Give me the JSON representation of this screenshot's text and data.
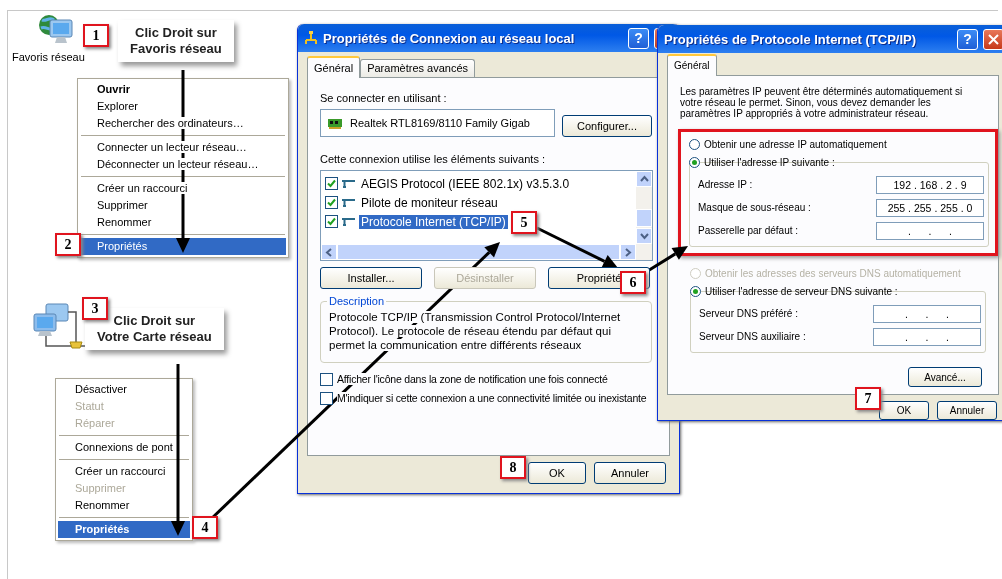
{
  "desktop_icons": [
    {
      "label": "Favoris réseau"
    }
  ],
  "callouts": [
    {
      "lines": [
        "Clic Droit sur",
        "Favoris réseau"
      ]
    },
    {
      "lines": [
        "Clic Droit sur",
        "Votre Carte réseau"
      ]
    }
  ],
  "menus": [
    {
      "items": [
        {
          "kind": "item",
          "label": "Ouvrir",
          "default": true,
          "disabled": false,
          "selected": false
        },
        {
          "kind": "item",
          "label": "Explorer",
          "default": false,
          "disabled": false,
          "selected": false
        },
        {
          "kind": "item",
          "label": "Rechercher des ordinateurs…",
          "default": false,
          "disabled": false,
          "selected": false
        },
        {
          "kind": "separator"
        },
        {
          "kind": "item",
          "label": "Connecter un lecteur réseau…",
          "default": false,
          "disabled": false,
          "selected": false
        },
        {
          "kind": "item",
          "label": "Déconnecter un lecteur réseau…",
          "default": false,
          "disabled": false,
          "selected": false
        },
        {
          "kind": "separator"
        },
        {
          "kind": "item",
          "label": "Créer un raccourci",
          "default": false,
          "disabled": false,
          "selected": false
        },
        {
          "kind": "item",
          "label": "Supprimer",
          "default": false,
          "disabled": false,
          "selected": false
        },
        {
          "kind": "item",
          "label": "Renommer",
          "default": false,
          "disabled": false,
          "selected": false
        },
        {
          "kind": "separator"
        },
        {
          "kind": "item",
          "label": "Propriétés",
          "default": false,
          "disabled": false,
          "selected": true
        }
      ]
    },
    {
      "items": [
        {
          "kind": "item",
          "label": "Désactiver",
          "default": false,
          "disabled": false,
          "selected": false
        },
        {
          "kind": "item",
          "label": "Statut",
          "default": false,
          "disabled": true,
          "selected": false
        },
        {
          "kind": "item",
          "label": "Réparer",
          "default": false,
          "disabled": true,
          "selected": false
        },
        {
          "kind": "separator"
        },
        {
          "kind": "item",
          "label": "Connexions de pont",
          "default": false,
          "disabled": false,
          "selected": false
        },
        {
          "kind": "separator"
        },
        {
          "kind": "item",
          "label": "Créer un raccourci",
          "default": false,
          "disabled": false,
          "selected": false
        },
        {
          "kind": "item",
          "label": "Supprimer",
          "default": false,
          "disabled": true,
          "selected": false
        },
        {
          "kind": "item",
          "label": "Renommer",
          "default": false,
          "disabled": false,
          "selected": false
        },
        {
          "kind": "separator"
        },
        {
          "kind": "item",
          "label": "Propriétés",
          "default": true,
          "disabled": false,
          "selected": true
        }
      ]
    }
  ],
  "step_badges": [
    "1",
    "2",
    "3",
    "4",
    "5",
    "6",
    "7",
    "8"
  ],
  "connection_dialog": {
    "title": "Propriétés de Connexion au réseau local",
    "help_button": "?",
    "tabs": [
      {
        "label": "Général",
        "selected": true
      },
      {
        "label": "Paramètres avancés",
        "selected": false
      }
    ],
    "connect_using_label": "Se connecter en utilisant :",
    "adapter": "Realtek RTL8169/8110 Family Gigab",
    "configure_button": "Configurer...",
    "components_label": "Cette connexion utilise les éléments suivants :",
    "components": [
      {
        "label": "AEGIS Protocol (IEEE 802.1x) v3.5.3.0",
        "checked": true,
        "selected": false
      },
      {
        "label": "Pilote de moniteur réseau",
        "checked": true,
        "selected": false
      },
      {
        "label": "Protocole Internet (TCP/IP)",
        "checked": true,
        "selected": true
      }
    ],
    "buttons": [
      {
        "label": "Installer...",
        "disabled": false
      },
      {
        "label": "Désinstaller",
        "disabled": true
      },
      {
        "label": "Propriété",
        "disabled": false
      }
    ],
    "description_title": "Description",
    "description_text": "Protocole TCP/IP (Transmission Control Protocol/Internet Protocol). Le protocole de réseau étendu par défaut qui permet la communication entre différents réseaux",
    "options": [
      {
        "label": "Afficher l'icône dans la zone de notification une fois connecté",
        "checked": false
      },
      {
        "label": "M'indiquer si cette connexion a une connectivité limitée ou inexistante",
        "checked": false
      }
    ],
    "footer_buttons": [
      "OK",
      "Annuler"
    ]
  },
  "tcpip_dialog": {
    "title": "Propriétés de Protocole Internet (TCP/IP)",
    "help_button": "?",
    "tabs": [
      {
        "label": "Général",
        "selected": true
      }
    ],
    "intro": "Les paramètres IP peuvent être déterminés automatiquement si votre réseau le permet. Sinon, vous devez demander les paramètres IP appropriés à votre administrateur réseau.",
    "ip_modes": [
      {
        "label": "Obtenir une adresse IP automatiquement",
        "selected": false,
        "disabled": false
      },
      {
        "label": "Utiliser l'adresse IP suivante :",
        "selected": true,
        "disabled": false
      }
    ],
    "ip_fields": [
      {
        "label": "Adresse IP :",
        "value": "192 . 168 . 2 . 9"
      },
      {
        "label": "Masque de sous-réseau :",
        "value": "255 . 255 . 255 . 0"
      },
      {
        "label": "Passerelle par défaut :",
        "value": ".      .      ."
      }
    ],
    "dns_modes": [
      {
        "label": "Obtenir les adresses des serveurs DNS automatiquement",
        "selected": false,
        "disabled": true
      },
      {
        "label": "Utiliser l'adresse de serveur DNS suivante :",
        "selected": true,
        "disabled": false
      }
    ],
    "dns_fields": [
      {
        "label": "Serveur DNS préféré :",
        "value": ".      .      ."
      },
      {
        "label": "Serveur DNS auxiliaire :",
        "value": ".      .      ."
      }
    ],
    "advanced_button": "Avancé...",
    "footer_buttons": [
      "OK",
      "Annuler"
    ]
  }
}
